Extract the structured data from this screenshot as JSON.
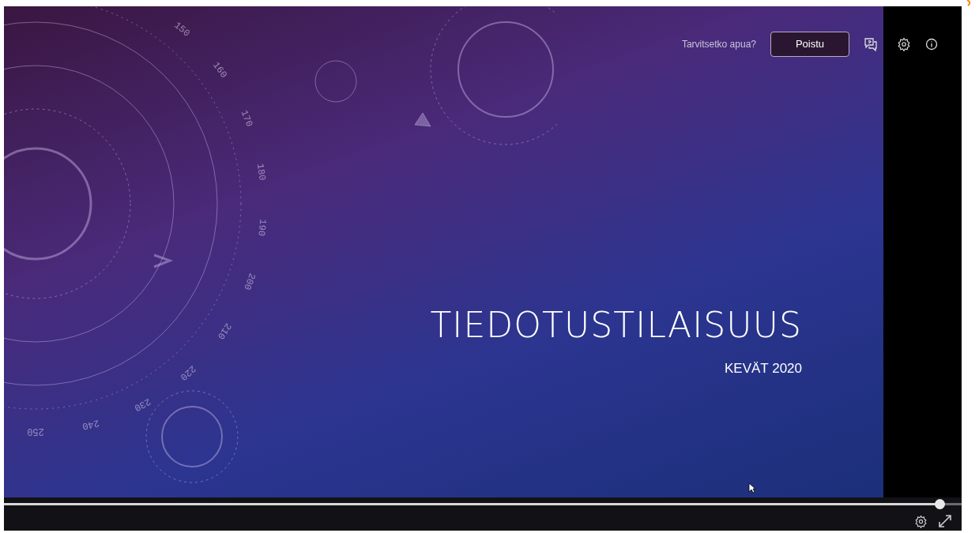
{
  "slide": {
    "title": "TIEDOTUSTILAISUUS",
    "subtitle": "KEVÄT 2020",
    "dial_labels": [
      "150",
      "160",
      "170",
      "180",
      "190",
      "200",
      "210",
      "220",
      "230",
      "240",
      "250"
    ]
  },
  "top_bar": {
    "help_text": "Tarvitsetko apua?",
    "exit_button": "Poistu"
  },
  "player": {
    "progress": {
      "level": 0.977
    }
  }
}
